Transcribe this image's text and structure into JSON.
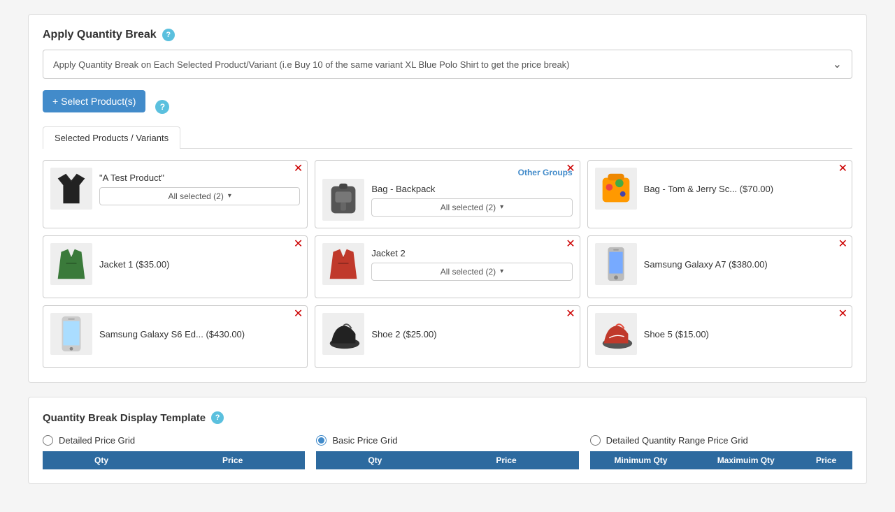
{
  "applyQuantityBreak": {
    "sectionTitle": "Apply Quantity Break",
    "dropdownText": "Apply Quantity Break on Each Selected Product/Variant (i.e Buy 10 of the same variant XL Blue Polo Shirt to get the price break)",
    "helpIcon": "?",
    "selectProductsBtn": "+ Select Product(s)",
    "selectProductsHelp": "?",
    "tab": {
      "label": "Selected Products / Variants"
    },
    "products": [
      {
        "id": "test-product",
        "name": "\"A Test Product\"",
        "hasVariantDropdown": true,
        "variantDropdownText": "All selected (2)",
        "otherGroups": false,
        "imgType": "shirt"
      },
      {
        "id": "bag-backpack",
        "name": "Bag - Backpack",
        "hasVariantDropdown": true,
        "variantDropdownText": "All selected (2)",
        "otherGroups": true,
        "otherGroupsLabel": "Other Groups",
        "imgType": "backpack"
      },
      {
        "id": "bag-tom-jerry",
        "name": "Bag - Tom & Jerry Sc... ($70.00)",
        "hasVariantDropdown": false,
        "otherGroups": false,
        "imgType": "bag-colorful"
      },
      {
        "id": "jacket-1",
        "name": "Jacket 1 ($35.00)",
        "hasVariantDropdown": false,
        "otherGroups": false,
        "imgType": "jacket-green"
      },
      {
        "id": "jacket-2",
        "name": "Jacket 2",
        "hasVariantDropdown": true,
        "variantDropdownText": "All selected (2)",
        "otherGroups": false,
        "imgType": "jacket-red"
      },
      {
        "id": "samsung-a7",
        "name": "Samsung Galaxy A7 ($380.00)",
        "hasVariantDropdown": false,
        "otherGroups": false,
        "imgType": "phone-a7"
      },
      {
        "id": "samsung-s6",
        "name": "Samsung Galaxy S6 Ed... ($430.00)",
        "hasVariantDropdown": false,
        "otherGroups": false,
        "imgType": "phone-s6"
      },
      {
        "id": "shoe-2",
        "name": "Shoe 2 ($25.00)",
        "hasVariantDropdown": false,
        "otherGroups": false,
        "imgType": "shoe-black"
      },
      {
        "id": "shoe-5",
        "name": "Shoe 5 ($15.00)",
        "hasVariantDropdown": false,
        "otherGroups": false,
        "imgType": "shoe-red"
      }
    ]
  },
  "quantityBreakDisplay": {
    "sectionTitle": "Quantity Break Display Template",
    "helpIcon": "?",
    "options": [
      {
        "id": "detailed-price-grid",
        "label": "Detailed Price Grid",
        "selected": false
      },
      {
        "id": "basic-price-grid",
        "label": "Basic Price Grid",
        "selected": true
      },
      {
        "id": "detailed-quantity-range",
        "label": "Detailed Quantity Range Price Grid",
        "selected": false
      }
    ],
    "tables": [
      {
        "id": "detailed-table",
        "columns": [
          "Qty",
          "Price"
        ]
      },
      {
        "id": "basic-table",
        "columns": [
          "Qty",
          "Price"
        ]
      },
      {
        "id": "range-table",
        "columns": [
          "Minimum Qty",
          "Maximuim Qty",
          "Price"
        ]
      }
    ]
  }
}
